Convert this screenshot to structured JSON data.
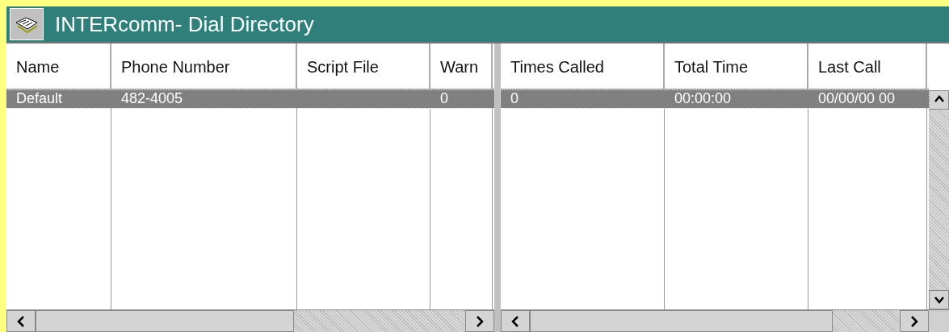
{
  "window": {
    "title": "INTERcomm- Dial Directory"
  },
  "panes": [
    {
      "columns": [
        "Name",
        "Phone Number",
        "Script File",
        "Warn"
      ],
      "rows": [
        {
          "selected": true,
          "cells": [
            "Default",
            "482-4005",
            "",
            "0"
          ]
        }
      ],
      "vertical_scrollbar": false
    },
    {
      "columns": [
        "Times Called",
        "Total Time",
        "Last Call"
      ],
      "rows": [
        {
          "selected": true,
          "cells": [
            "0",
            "00:00:00",
            "00/00/00 00"
          ]
        }
      ],
      "vertical_scrollbar": true
    }
  ]
}
